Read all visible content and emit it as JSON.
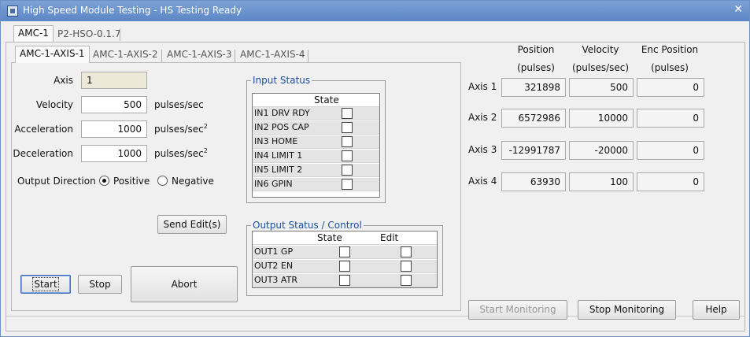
{
  "window": {
    "title": "High Speed Module Testing - HS Testing Ready"
  },
  "module_tabs": [
    {
      "label": "AMC-1",
      "selected": true
    },
    {
      "label": "P2-HSO-0.1.7",
      "selected": false
    }
  ],
  "axis_tabs": [
    {
      "label": "AMC-1-AXIS-1",
      "selected": true
    },
    {
      "label": "AMC-1-AXIS-2",
      "selected": false
    },
    {
      "label": "AMC-1-AXIS-3",
      "selected": false
    },
    {
      "label": "AMC-1-AXIS-4",
      "selected": false
    }
  ],
  "axis_form": {
    "axis_label": "Axis",
    "axis_value": "1",
    "velocity_label": "Velocity",
    "velocity_value": "500",
    "velocity_unit": "pulses/sec",
    "acceleration_label": "Acceleration",
    "acceleration_value": "1000",
    "acceleration_unit": "pulses/sec",
    "deceleration_label": "Deceleration",
    "deceleration_value": "1000",
    "deceleration_unit": "pulses/sec",
    "unit_exponent": "2",
    "direction_label": "Output Direction",
    "direction_positive": "Positive",
    "direction_negative": "Negative",
    "direction_selected": "Positive"
  },
  "input_status": {
    "title": "Input Status",
    "col_state": "State",
    "rows": [
      "IN1 DRV RDY",
      "IN2 POS CAP",
      "IN3 HOME",
      "IN4 LIMIT 1",
      "IN5 LIMIT 2",
      "IN6 GPIN"
    ]
  },
  "output_status": {
    "title": "Output Status / Control",
    "col_state": "State",
    "col_edit": "Edit",
    "rows": [
      "OUT1 GP",
      "OUT2 EN",
      "OUT3 ATR"
    ]
  },
  "buttons": {
    "send_edits": "Send Edit(s)",
    "start": "Start",
    "stop": "Stop",
    "abort": "Abort",
    "start_monitoring": "Start Monitoring",
    "stop_monitoring": "Stop Monitoring",
    "help": "Help"
  },
  "monitor": {
    "col_position_1": "Position",
    "col_position_2": "(pulses)",
    "col_velocity_1": "Velocity",
    "col_velocity_2": "(pulses/sec)",
    "col_enc_1": "Enc Position",
    "col_enc_2": "(pulses)",
    "rows": [
      {
        "label": "Axis 1",
        "position": "321898",
        "velocity": "500",
        "enc": "0"
      },
      {
        "label": "Axis 2",
        "position": "6572986",
        "velocity": "10000",
        "enc": "0"
      },
      {
        "label": "Axis 3",
        "position": "-12991787",
        "velocity": "-20000",
        "enc": "0"
      },
      {
        "label": "Axis 4",
        "position": "63930",
        "velocity": "100",
        "enc": "0"
      }
    ]
  }
}
